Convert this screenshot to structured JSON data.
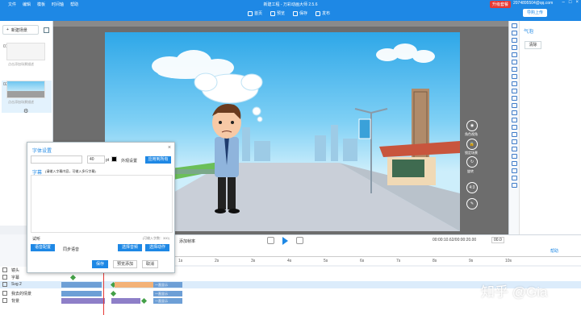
{
  "titlebar": {
    "menu": [
      "文件",
      "编辑",
      "模板",
      "时间轴",
      "帮助"
    ],
    "title": "新建工程 - 万彩动画大师 2.5.6",
    "upgrade": "升级套餐",
    "email": "2074895504@qq.com",
    "winctl": [
      "–",
      "□",
      "×"
    ]
  },
  "toolbar": {
    "actions": [
      {
        "label": "首页"
      },
      {
        "label": "预览"
      },
      {
        "label": "保存"
      },
      {
        "label": "发布"
      }
    ],
    "login": "导购上传"
  },
  "leftpanel": {
    "newscene": "新建场景",
    "scenes": [
      {
        "num": "01",
        "desc": "点击添加场景描述"
      },
      {
        "num": "02",
        "desc": "点击添加场景描述"
      }
    ]
  },
  "rightpanel": {
    "title": "气泡",
    "button": "清除"
  },
  "stage_ctrls": [
    {
      "label": "角色视角"
    },
    {
      "label": "锁定场景"
    },
    {
      "label": "旋转"
    },
    {
      "label": "4:3"
    }
  ],
  "playbar": {
    "left_label": "添加帧率",
    "time": "00:00:10.62/00:00:20.00",
    "zoom": "00.0"
  },
  "timeline": {
    "help": "帮助",
    "ticks": [
      "1s",
      "2s",
      "3s",
      "4s",
      "5s",
      "6s",
      "7s",
      "8s",
      "9s",
      "10s"
    ],
    "tracks": [
      {
        "name": "镜头"
      },
      {
        "name": "字幕"
      },
      {
        "name": "Svg 2"
      },
      {
        "name": "我去的情景"
      },
      {
        "name": "背景"
      }
    ],
    "segments": [
      "一直显示",
      "一直显示",
      "一直显示"
    ]
  },
  "dialog": {
    "title": "字体设置",
    "close": "×",
    "size": "40",
    "unit": "pt",
    "outer": "外观设置",
    "apply_all": "应用到所有",
    "sub_label": "字幕",
    "sub_text": "(请输入字幕内容，可输入多行字幕)",
    "trial": "试听",
    "limit": "(可输入字数：300)",
    "voice": "语音配置",
    "sync": "同步语音",
    "sel_voice": "选择音频",
    "sel_move": "选择动作",
    "buttons": [
      "保存",
      "预览添加",
      "取消"
    ]
  },
  "watermark": "知乎 @Gia"
}
